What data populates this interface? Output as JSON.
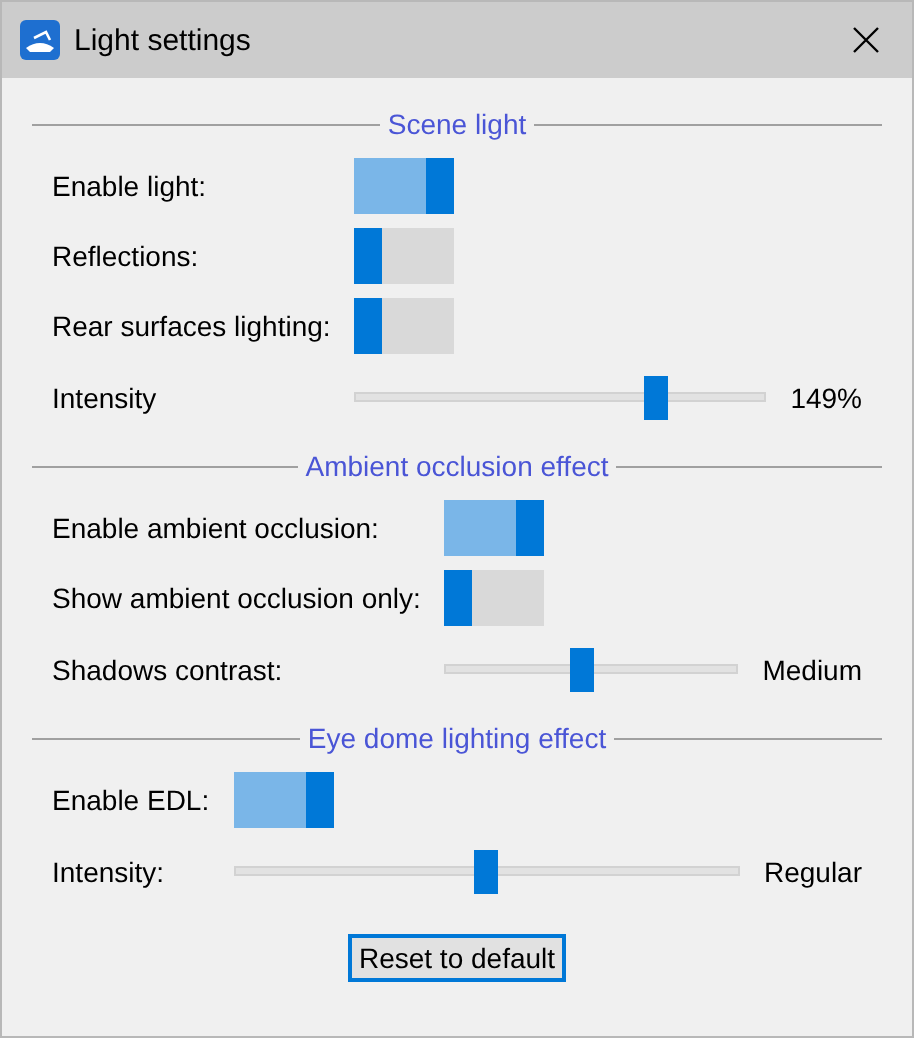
{
  "window": {
    "title": "Light settings"
  },
  "sections": [
    {
      "title": "Scene light",
      "rows": [
        {
          "kind": "toggle",
          "label": "Enable light:",
          "on": true
        },
        {
          "kind": "toggle",
          "label": "Reflections:",
          "on": false
        },
        {
          "kind": "toggle",
          "label": "Rear surfaces lighting:",
          "on": false
        },
        {
          "kind": "slider",
          "label": "Intensity",
          "level": 0.73,
          "reading": "149%"
        }
      ]
    },
    {
      "title": "Ambient occlusion effect",
      "rows": [
        {
          "kind": "toggle",
          "label": "Enable ambient occlusion:",
          "on": true
        },
        {
          "kind": "toggle",
          "label": "Show ambient occlusion only:",
          "on": false
        },
        {
          "kind": "slider",
          "label": "Shadows contrast:",
          "level": 0.47,
          "reading": "Medium"
        }
      ]
    },
    {
      "title": "Eye dome lighting effect",
      "rows": [
        {
          "kind": "toggle",
          "label": "Enable EDL:",
          "on": true
        },
        {
          "kind": "slider",
          "label": "Intensity:",
          "level": 0.5,
          "reading": "Regular"
        }
      ]
    }
  ],
  "buttons": [
    "Reset to default"
  ]
}
